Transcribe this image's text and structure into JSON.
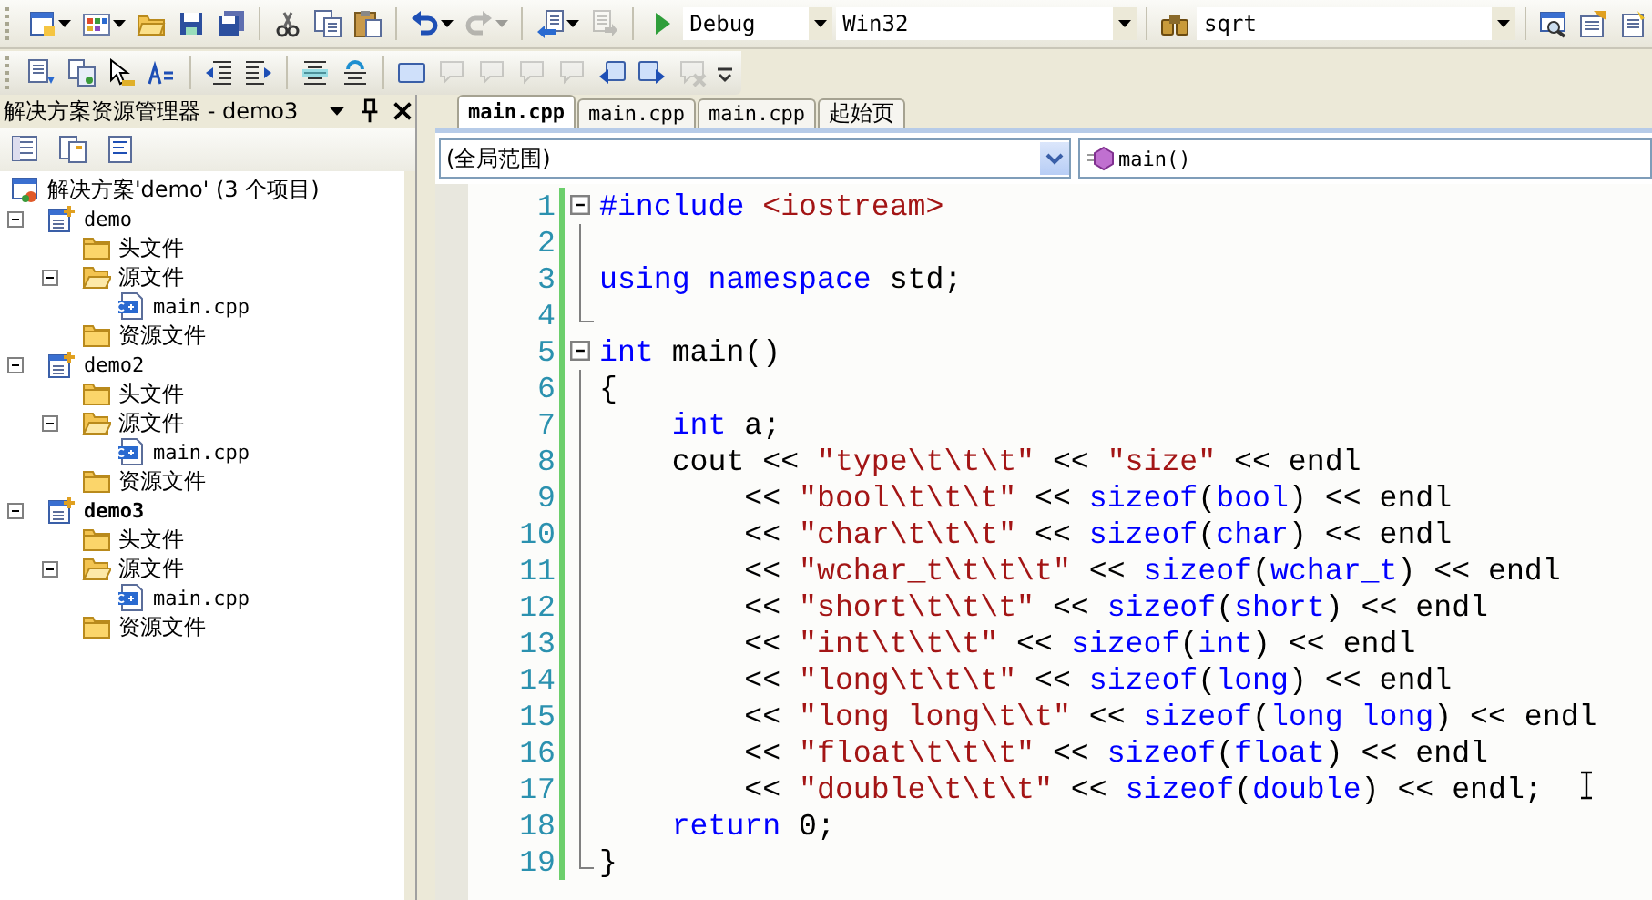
{
  "toolbar_1": {
    "buttons": [
      {
        "disabled": false
      },
      {
        "disabled": false
      },
      {
        "disabled": false
      },
      {
        "disabled": false
      },
      {
        "disabled": false
      },
      {
        "disabled": false
      },
      {
        "disabled": false
      },
      {
        "disabled": false
      },
      {
        "disabled": false
      },
      {
        "disabled": true
      },
      {
        "disabled": false
      },
      {
        "disabled": true
      },
      {
        "disabled": false
      }
    ],
    "configuration": {
      "value": "Debug"
    },
    "platform": {
      "value": "Win32"
    },
    "find": {
      "value": "sqrt"
    }
  },
  "toolbar_2": {
    "buttons": [
      {
        "disabled": false
      },
      {
        "disabled": false
      },
      {
        "disabled": false
      },
      {
        "disabled": false
      },
      {
        "disabled": false
      },
      {
        "disabled": false
      },
      {
        "disabled": false
      },
      {
        "disabled": false
      },
      {
        "disabled": false
      },
      {
        "disabled": true
      },
      {
        "disabled": true
      },
      {
        "disabled": true
      },
      {
        "disabled": true
      },
      {
        "disabled": false
      },
      {
        "disabled": false
      },
      {
        "disabled": true
      }
    ]
  },
  "solution_explorer": {
    "title": "解决方案资源管理器 - demo3",
    "tree": {
      "label": "解决方案'demo' (3 个项目)",
      "kind": "solution",
      "children": [
        {
          "label": "demo",
          "kind": "project",
          "bold": false,
          "expanded": true,
          "children": [
            {
              "label": "头文件",
              "kind": "folder"
            },
            {
              "label": "源文件",
              "kind": "folder",
              "expanded": true,
              "children": [
                {
                  "label": "main.cpp",
                  "kind": "file"
                }
              ]
            },
            {
              "label": "资源文件",
              "kind": "folder"
            }
          ]
        },
        {
          "label": "demo2",
          "kind": "project",
          "bold": false,
          "expanded": true,
          "children": [
            {
              "label": "头文件",
              "kind": "folder"
            },
            {
              "label": "源文件",
              "kind": "folder",
              "expanded": true,
              "children": [
                {
                  "label": "main.cpp",
                  "kind": "file"
                }
              ]
            },
            {
              "label": "资源文件",
              "kind": "folder"
            }
          ]
        },
        {
          "label": "demo3",
          "kind": "project",
          "bold": true,
          "expanded": true,
          "children": [
            {
              "label": "头文件",
              "kind": "folder"
            },
            {
              "label": "源文件",
              "kind": "folder",
              "expanded": true,
              "children": [
                {
                  "label": "main.cpp",
                  "kind": "file"
                }
              ]
            },
            {
              "label": "资源文件",
              "kind": "folder"
            }
          ]
        }
      ]
    }
  },
  "editor": {
    "tabs": [
      {
        "label": "main.cpp",
        "selected": true
      },
      {
        "label": "main.cpp",
        "selected": false
      },
      {
        "label": "main.cpp",
        "selected": false
      },
      {
        "label": "起始页",
        "selected": false
      }
    ],
    "scope": {
      "value": "(全局范围)"
    },
    "member": {
      "value": "main()"
    },
    "lines": [
      {
        "number": "1",
        "collapsible": true,
        "block_end": false,
        "tokens": [
          {
            "kind": "keyword",
            "text": "#include"
          },
          {
            "kind": "string",
            "text": " <iostream>"
          }
        ]
      },
      {
        "number": "2",
        "collapsible": false,
        "block_end": false
      },
      {
        "number": "3",
        "collapsible": false,
        "block_end": false,
        "tokens": [
          {
            "kind": "keyword",
            "text": "using namespace"
          },
          {
            "kind": "plain",
            "text": " std;"
          }
        ]
      },
      {
        "number": "4",
        "collapsible": false,
        "block_end": true
      },
      {
        "number": "5",
        "collapsible": true,
        "block_end": false,
        "tokens": [
          {
            "kind": "keyword",
            "text": "int"
          },
          {
            "kind": "plain",
            "text": " main()"
          }
        ]
      },
      {
        "number": "6",
        "collapsible": false,
        "block_end": false,
        "tokens": [
          {
            "kind": "plain",
            "text": "{"
          }
        ]
      },
      {
        "number": "7",
        "collapsible": false,
        "block_end": false,
        "tokens": [
          {
            "kind": "keyword",
            "text": "    int"
          },
          {
            "kind": "plain",
            "text": " a;"
          }
        ]
      },
      {
        "number": "8",
        "collapsible": false,
        "block_end": false,
        "tokens": [
          {
            "kind": "plain",
            "text": "    cout << "
          },
          {
            "kind": "string",
            "text": "\"type\\t\\t\\t\""
          },
          {
            "kind": "plain",
            "text": " << "
          },
          {
            "kind": "string",
            "text": "\"size\""
          },
          {
            "kind": "plain",
            "text": " << endl"
          }
        ]
      },
      {
        "number": "9",
        "collapsible": false,
        "block_end": false,
        "tokens": [
          {
            "kind": "plain",
            "text": "        << "
          },
          {
            "kind": "string",
            "text": "\"bool\\t\\t\\t\""
          },
          {
            "kind": "plain",
            "text": " << "
          },
          {
            "kind": "keyword",
            "text": "sizeof"
          },
          {
            "kind": "plain",
            "text": "("
          },
          {
            "kind": "keyword",
            "text": "bool"
          },
          {
            "kind": "plain",
            "text": ") << endl"
          }
        ]
      },
      {
        "number": "10",
        "collapsible": false,
        "block_end": false,
        "tokens": [
          {
            "kind": "plain",
            "text": "        << "
          },
          {
            "kind": "string",
            "text": "\"char\\t\\t\\t\""
          },
          {
            "kind": "plain",
            "text": " << "
          },
          {
            "kind": "keyword",
            "text": "sizeof"
          },
          {
            "kind": "plain",
            "text": "("
          },
          {
            "kind": "keyword",
            "text": "char"
          },
          {
            "kind": "plain",
            "text": ") << endl"
          }
        ]
      },
      {
        "number": "11",
        "collapsible": false,
        "block_end": false,
        "tokens": [
          {
            "kind": "plain",
            "text": "        << "
          },
          {
            "kind": "string",
            "text": "\"wchar_t\\t\\t\\t\""
          },
          {
            "kind": "plain",
            "text": " << "
          },
          {
            "kind": "keyword",
            "text": "sizeof"
          },
          {
            "kind": "plain",
            "text": "("
          },
          {
            "kind": "keyword",
            "text": "wchar_t"
          },
          {
            "kind": "plain",
            "text": ") << endl"
          }
        ]
      },
      {
        "number": "12",
        "collapsible": false,
        "block_end": false,
        "tokens": [
          {
            "kind": "plain",
            "text": "        << "
          },
          {
            "kind": "string",
            "text": "\"short\\t\\t\\t\""
          },
          {
            "kind": "plain",
            "text": " << "
          },
          {
            "kind": "keyword",
            "text": "sizeof"
          },
          {
            "kind": "plain",
            "text": "("
          },
          {
            "kind": "keyword",
            "text": "short"
          },
          {
            "kind": "plain",
            "text": ") << endl"
          }
        ]
      },
      {
        "number": "13",
        "collapsible": false,
        "block_end": false,
        "tokens": [
          {
            "kind": "plain",
            "text": "        << "
          },
          {
            "kind": "string",
            "text": "\"int\\t\\t\\t\""
          },
          {
            "kind": "plain",
            "text": " << "
          },
          {
            "kind": "keyword",
            "text": "sizeof"
          },
          {
            "kind": "plain",
            "text": "("
          },
          {
            "kind": "keyword",
            "text": "int"
          },
          {
            "kind": "plain",
            "text": ") << endl"
          }
        ]
      },
      {
        "number": "14",
        "collapsible": false,
        "block_end": false,
        "tokens": [
          {
            "kind": "plain",
            "text": "        << "
          },
          {
            "kind": "string",
            "text": "\"long\\t\\t\\t\""
          },
          {
            "kind": "plain",
            "text": " << "
          },
          {
            "kind": "keyword",
            "text": "sizeof"
          },
          {
            "kind": "plain",
            "text": "("
          },
          {
            "kind": "keyword",
            "text": "long"
          },
          {
            "kind": "plain",
            "text": ") << endl"
          }
        ]
      },
      {
        "number": "15",
        "collapsible": false,
        "block_end": false,
        "tokens": [
          {
            "kind": "plain",
            "text": "        << "
          },
          {
            "kind": "string",
            "text": "\"long long\\t\\t\""
          },
          {
            "kind": "plain",
            "text": " << "
          },
          {
            "kind": "keyword",
            "text": "sizeof"
          },
          {
            "kind": "plain",
            "text": "("
          },
          {
            "kind": "keyword",
            "text": "long long"
          },
          {
            "kind": "plain",
            "text": ") << endl"
          }
        ]
      },
      {
        "number": "16",
        "collapsible": false,
        "block_end": false,
        "tokens": [
          {
            "kind": "plain",
            "text": "        << "
          },
          {
            "kind": "string",
            "text": "\"float\\t\\t\\t\""
          },
          {
            "kind": "plain",
            "text": " << "
          },
          {
            "kind": "keyword",
            "text": "sizeof"
          },
          {
            "kind": "plain",
            "text": "("
          },
          {
            "kind": "keyword",
            "text": "float"
          },
          {
            "kind": "plain",
            "text": ") << endl"
          }
        ]
      },
      {
        "number": "17",
        "collapsible": false,
        "block_end": false,
        "tokens": [
          {
            "kind": "plain",
            "text": "        << "
          },
          {
            "kind": "string",
            "text": "\"double\\t\\t\\t\""
          },
          {
            "kind": "plain",
            "text": " << "
          },
          {
            "kind": "keyword",
            "text": "sizeof"
          },
          {
            "kind": "plain",
            "text": "("
          },
          {
            "kind": "keyword",
            "text": "double"
          },
          {
            "kind": "plain",
            "text": ") << endl;"
          }
        ]
      },
      {
        "number": "18",
        "collapsible": false,
        "block_end": false,
        "tokens": [
          {
            "kind": "keyword",
            "text": "    return"
          },
          {
            "kind": "plain",
            "text": " 0;"
          }
        ]
      },
      {
        "number": "19",
        "collapsible": false,
        "block_end": true,
        "tokens": [
          {
            "kind": "plain",
            "text": "}"
          }
        ]
      }
    ]
  }
}
